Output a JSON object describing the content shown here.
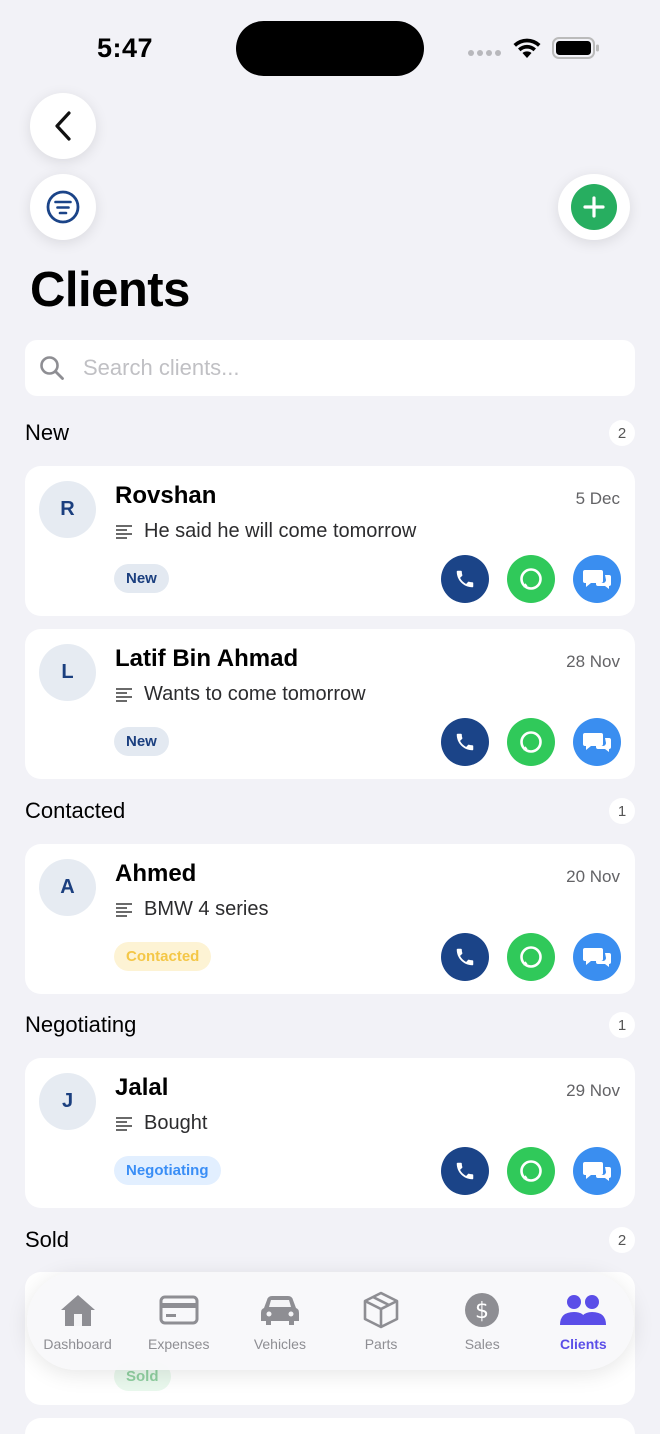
{
  "status_bar": {
    "time": "5:47"
  },
  "header": {
    "title": "Clients"
  },
  "search": {
    "placeholder": "Search clients...",
    "value": ""
  },
  "sections": {
    "new": {
      "title": "New",
      "count": "2",
      "items": [
        {
          "initial": "R",
          "name": "Rovshan",
          "date": "5 Dec",
          "note": "He said he will come tomorrow",
          "status": "New"
        },
        {
          "initial": "L",
          "name": "Latif Bin Ahmad",
          "date": "28 Nov",
          "note": "Wants to come tomorrow",
          "status": "New"
        }
      ]
    },
    "contacted": {
      "title": "Contacted",
      "count": "1",
      "items": [
        {
          "initial": "A",
          "name": "Ahmed",
          "date": "20 Nov",
          "note": "BMW 4 series",
          "status": "Contacted"
        }
      ]
    },
    "negotiating": {
      "title": "Negotiating",
      "count": "1",
      "items": [
        {
          "initial": "J",
          "name": "Jalal",
          "date": "29 Nov",
          "note": "Bought",
          "status": "Negotiating"
        }
      ]
    },
    "sold": {
      "title": "Sold",
      "count": "2",
      "items": [
        {
          "status": "Sold"
        }
      ]
    }
  },
  "tabbar": {
    "tabs": [
      {
        "label": "Dashboard",
        "icon": "house-icon"
      },
      {
        "label": "Expenses",
        "icon": "card-icon"
      },
      {
        "label": "Vehicles",
        "icon": "car-icon"
      },
      {
        "label": "Parts",
        "icon": "box-icon"
      },
      {
        "label": "Sales",
        "icon": "dollar-icon"
      },
      {
        "label": "Clients",
        "icon": "people-icon",
        "active": true
      }
    ]
  },
  "colors": {
    "accent": "#5b4ee8",
    "call": "#1b4488",
    "whatsapp": "#30c95a",
    "message": "#3a8ef0",
    "add": "#27ae60"
  }
}
